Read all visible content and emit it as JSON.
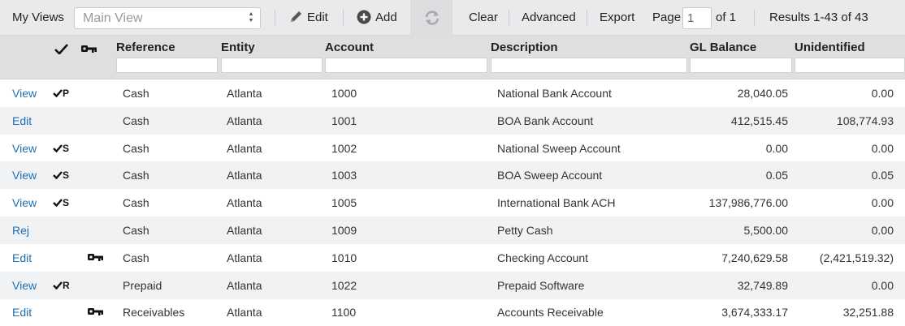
{
  "toolbar": {
    "my_views_label": "My Views",
    "view_select_value": "Main View",
    "edit_label": "Edit",
    "add_label": "Add",
    "clear_label": "Clear",
    "advanced_label": "Advanced",
    "export_label": "Export",
    "page_label": "Page",
    "page_value": "1",
    "page_of": "of 1",
    "results": "Results 1-43 of 43"
  },
  "columns": {
    "reference": "Reference",
    "entity": "Entity",
    "account": "Account",
    "description": "Description",
    "gl_balance": "GL Balance",
    "unidentified": "Unidentified"
  },
  "rows": [
    {
      "action": "View",
      "flag": "P",
      "checked": true,
      "key": false,
      "reference": "Cash",
      "entity": "Atlanta",
      "account": "1000",
      "description": "National Bank Account",
      "gl_balance": "28,040.05",
      "unidentified": "0.00"
    },
    {
      "action": "Edit",
      "flag": "",
      "checked": false,
      "key": false,
      "reference": "Cash",
      "entity": "Atlanta",
      "account": "1001",
      "description": "BOA Bank Account",
      "gl_balance": "412,515.45",
      "unidentified": "108,774.93"
    },
    {
      "action": "View",
      "flag": "S",
      "checked": true,
      "key": false,
      "reference": "Cash",
      "entity": "Atlanta",
      "account": "1002",
      "description": "National Sweep Account",
      "gl_balance": "0.00",
      "unidentified": "0.00"
    },
    {
      "action": "View",
      "flag": "S",
      "checked": true,
      "key": false,
      "reference": "Cash",
      "entity": "Atlanta",
      "account": "1003",
      "description": "BOA Sweep Account",
      "gl_balance": "0.05",
      "unidentified": "0.05"
    },
    {
      "action": "View",
      "flag": "S",
      "checked": true,
      "key": false,
      "reference": "Cash",
      "entity": "Atlanta",
      "account": "1005",
      "description": "International Bank ACH",
      "gl_balance": "137,986,776.00",
      "unidentified": "0.00"
    },
    {
      "action": "Rej",
      "flag": "",
      "checked": false,
      "key": false,
      "reference": "Cash",
      "entity": "Atlanta",
      "account": "1009",
      "description": "Petty Cash",
      "gl_balance": "5,500.00",
      "unidentified": "0.00"
    },
    {
      "action": "Edit",
      "flag": "",
      "checked": false,
      "key": true,
      "reference": "Cash",
      "entity": "Atlanta",
      "account": "1010",
      "description": "Checking Account",
      "gl_balance": "7,240,629.58",
      "unidentified": "(2,421,519.32)"
    },
    {
      "action": "View",
      "flag": "R",
      "checked": true,
      "key": false,
      "reference": "Prepaid",
      "entity": "Atlanta",
      "account": "1022",
      "description": "Prepaid Software",
      "gl_balance": "32,749.89",
      "unidentified": "0.00"
    },
    {
      "action": "Edit",
      "flag": "",
      "checked": false,
      "key": true,
      "reference": "Receivables",
      "entity": "Atlanta",
      "account": "1100",
      "description": "Accounts Receivable",
      "gl_balance": "3,674,333.17",
      "unidentified": "32,251.88"
    }
  ],
  "icons": {
    "edit": "pencil-icon",
    "add": "plus-circle-icon",
    "refresh": "refresh-icon",
    "checkmark": "checkmark-icon",
    "key": "key-icon"
  },
  "colors": {
    "link": "#1f6fb4",
    "toolbar_bg": "#e9eaeb",
    "header_bg": "#dddfe1",
    "alt_row_bg": "#f1f2f3"
  }
}
